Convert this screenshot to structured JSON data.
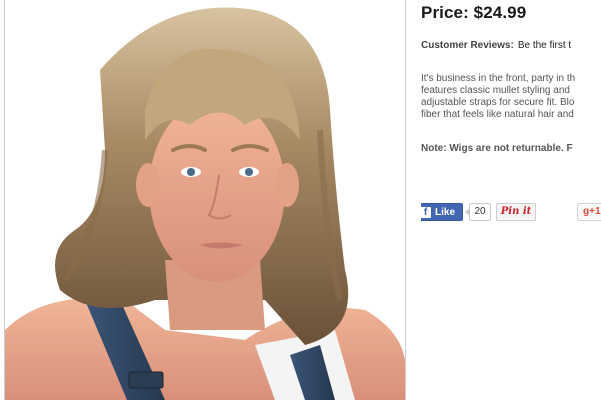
{
  "product": {
    "price": "Price: $24.99",
    "reviews_label": "Customer Reviews:",
    "reviews_value": "Be the first t",
    "description_lines": [
      "It's business in the front, party in th",
      "features classic mullet styling and",
      "adjustable straps for secure fit. Blo",
      "fiber that feels like natural hair and"
    ],
    "note": "Note: Wigs are not returnable. F"
  },
  "social": {
    "like_label": "Like",
    "like_count": "20",
    "pin_label": "Pin it",
    "gplus_label": "g+1"
  },
  "colors": {
    "facebook": "#4267b2",
    "pinterest": "#cb2027",
    "google_plus": "#dd4b39"
  }
}
